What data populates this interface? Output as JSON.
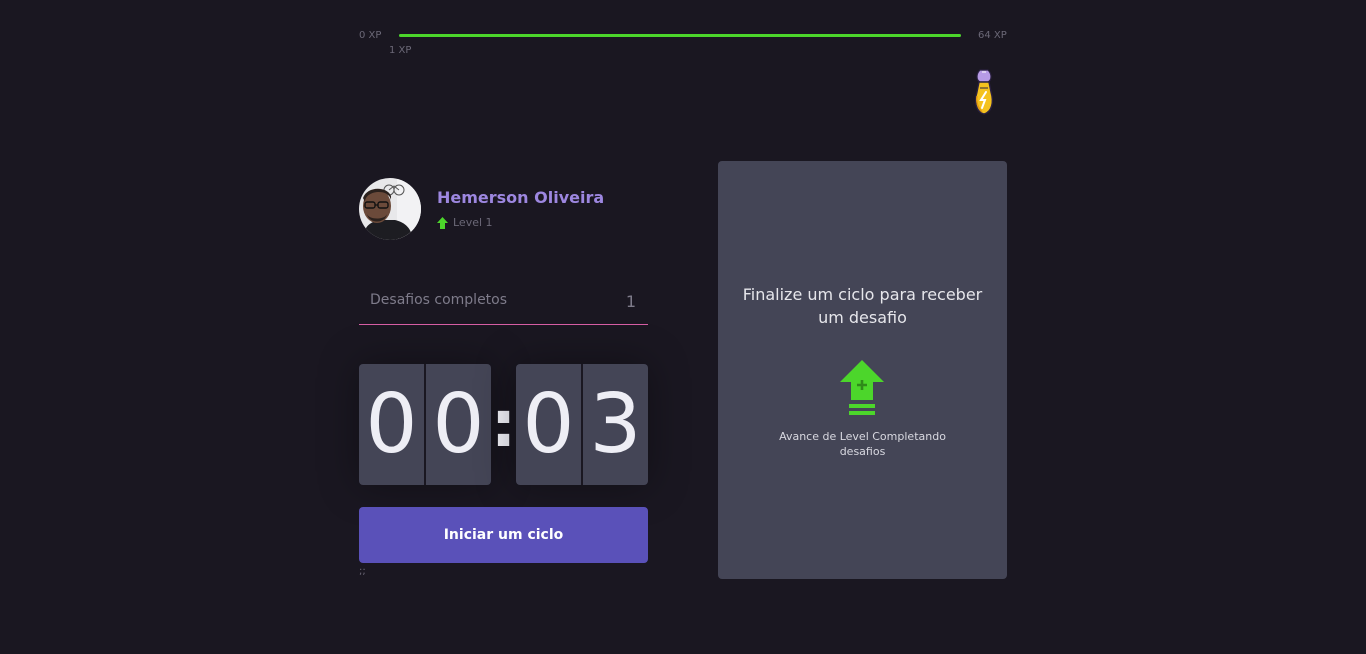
{
  "xp": {
    "min_label": "0 XP",
    "max_label": "64 XP",
    "current_label": "1 XP",
    "progress_fraction": 1.0,
    "bar_color": "#4cd62b"
  },
  "header": {
    "potion_icon": "potion-icon"
  },
  "profile": {
    "name": "Hemerson Oliveira",
    "level_icon": "level-up-arrow-icon",
    "level_text": "Level 1",
    "name_color": "#9d87e0"
  },
  "challenges": {
    "label": "Desafios completos",
    "count": "1",
    "underline_color": "#d65ea4"
  },
  "countdown": {
    "minutes": [
      "0",
      "0"
    ],
    "seconds": [
      "0",
      "3"
    ],
    "separator": ":"
  },
  "start_button": {
    "label": "Iniciar um ciclo",
    "color": "#5a51b9"
  },
  "stray_text": ";;",
  "challenge_box": {
    "title": "Finalize um ciclo para receber um desafio",
    "icon": "level-up-icon",
    "hint": "Avance de Level Completando desafios",
    "accent_color": "#4cd62b"
  }
}
